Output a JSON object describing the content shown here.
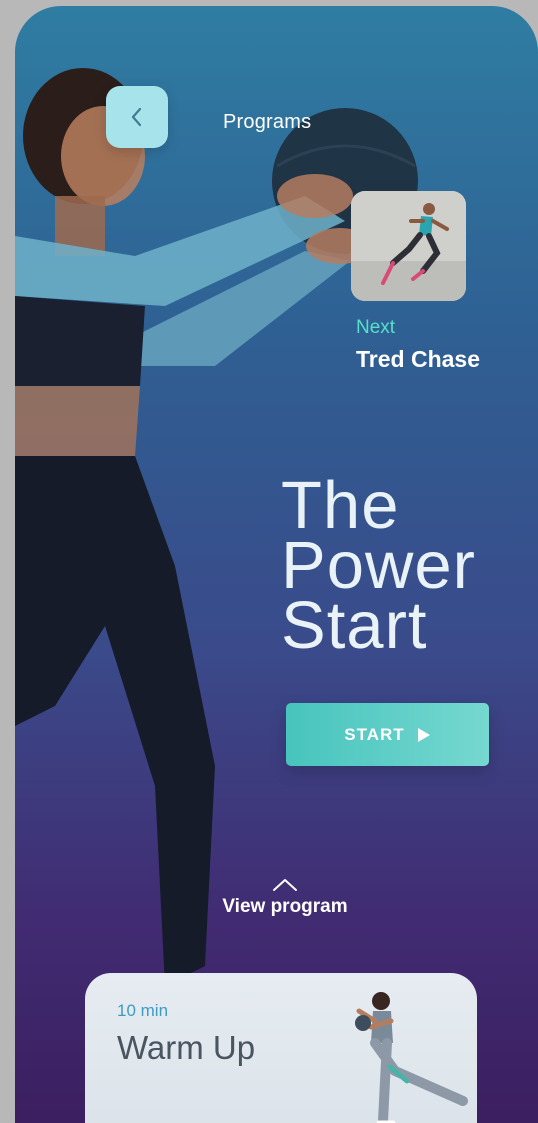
{
  "header": {
    "title": "Programs"
  },
  "next": {
    "label": "Next",
    "title": "Tred Chase"
  },
  "hero": {
    "title_lines": [
      "The",
      "Power",
      "Start"
    ]
  },
  "start_button": {
    "label": "START"
  },
  "view_program": {
    "label": "View program"
  },
  "warmup_card": {
    "duration": "10 min",
    "title": "Warm Up"
  },
  "colors": {
    "accent": "#56e0c8",
    "button": "#5ccfc7",
    "back_button": "#a7e3ea",
    "gradient_top": "#2f7da2",
    "gradient_bottom": "#3b1f60"
  },
  "icons": {
    "back": "chevron-left-icon",
    "play": "play-icon",
    "expand": "chevron-up-icon"
  }
}
